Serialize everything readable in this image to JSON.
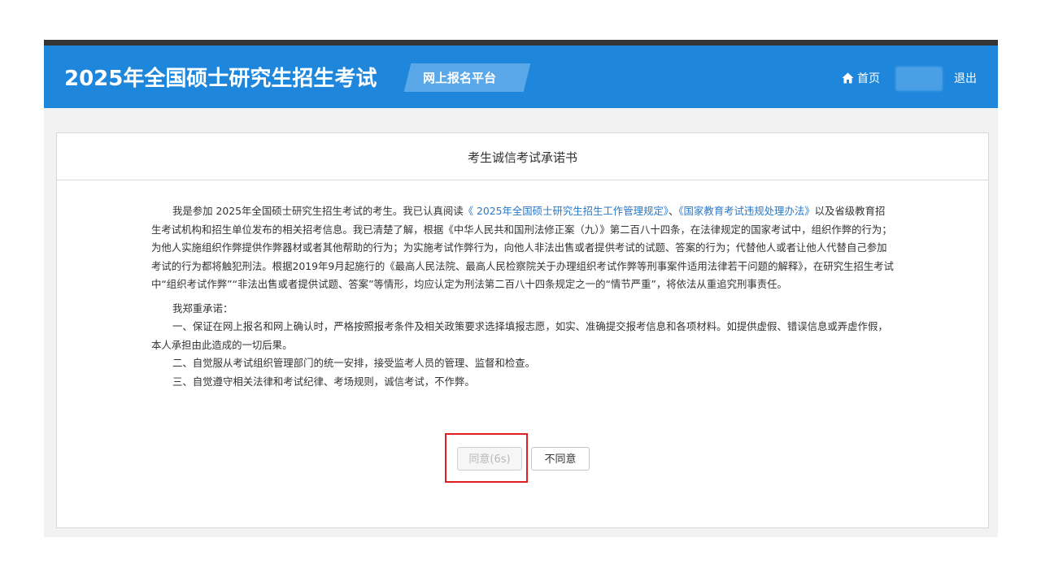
{
  "header": {
    "site_title": "2025年全国硕士研究生招生考试",
    "platform_label": "网上报名平台",
    "home_label": "首页",
    "logout_label": "退出",
    "colors": {
      "header_bg": "#1e87dc",
      "badge_bg": "#5aa8e8",
      "top_strip": "#353535"
    }
  },
  "card": {
    "title": "考生诚信考试承诺书",
    "para1": {
      "intro": "我是参加 2025年全国硕士研究生招生考试的考生。我已认真阅读",
      "link1": "《 2025年全国硕士研究生招生工作管理规定》",
      "sep": "、",
      "link2": "《国家教育考试违规处理办法》",
      "rest": "以及省级教育招生考试机构和招生单位发布的相关招考信息。我已清楚了解，根据《中华人民共和国刑法修正案（九）》第二百八十四条，在法律规定的国家考试中，组织作弊的行为；为他人实施组织作弊提供作弊器材或者其他帮助的行为；为实施考试作弊行为，向他人非法出售或者提供考试的试题、答案的行为；代替他人或者让他人代替自己参加考试的行为都将触犯刑法。根据2019年9月起施行的《最高人民法院、最高人民检察院关于办理组织考试作弊等刑事案件适用法律若干问题的解释》，在研究生招生考试中“组织考试作弊”“非法出售或者提供试题、答案”等情形，均应认定为刑法第二百八十四条规定之一的“情节严重”，将依法从重追究刑事责任。"
    },
    "pledge_intro": "我郑重承诺：",
    "pledge_items": [
      "一、保证在网上报名和网上确认时，严格按照报考条件及相关政策要求选择填报志愿，如实、准确提交报考信息和各项材料。如提供虚假、错误信息或弄虚作假，本人承担由此造成的一切后果。",
      "二、自觉服从考试组织管理部门的统一安排，接受监考人员的管理、监督和检查。",
      "三、自觉遵守相关法律和考试纪律、考场规则，诚信考试，不作弊。"
    ],
    "buttons": {
      "agree_label": "同意(6s)",
      "agree_disabled": true,
      "disagree_label": "不同意"
    }
  }
}
